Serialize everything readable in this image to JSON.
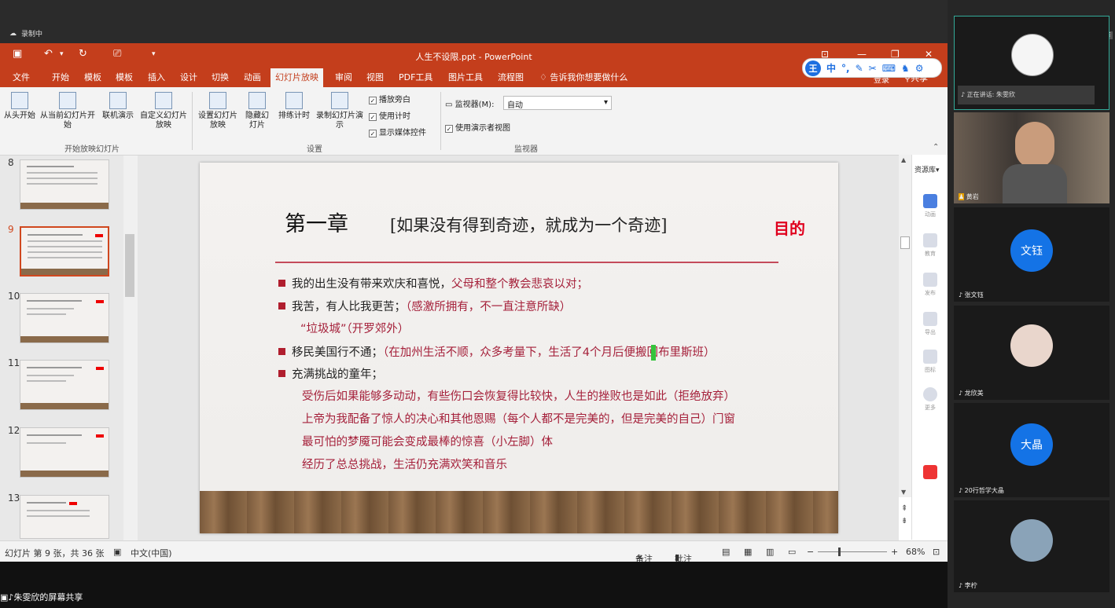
{
  "recording": {
    "label": "录制中"
  },
  "ppt": {
    "window_title": "人生不设限.ppt - PowerPoint",
    "tabs": [
      "文件",
      "开始",
      "模板",
      "模板",
      "插入",
      "设计",
      "切换",
      "动画",
      "幻灯片放映",
      "审阅",
      "视图",
      "PDF工具",
      "图片工具",
      "流程图"
    ],
    "active_tab": "幻灯片放映",
    "tell_me": "告诉我你想要做什么",
    "login": "登录",
    "share": "共享",
    "ime_logo": "王",
    "ime_mode": "中",
    "ribbon": {
      "from_start": "从头开始",
      "from_current": "从当前幻灯片开始",
      "online": "联机演示",
      "custom": "自定义幻灯片放映",
      "group1": "开始放映幻灯片",
      "setup": "设置幻灯片放映",
      "hide": "隐藏幻灯片",
      "rehearse": "排练计时",
      "record": "录制幻灯片演示",
      "play_narration": "播放旁白",
      "use_timings": "使用计时",
      "show_media": "显示媒体控件",
      "group2": "设置",
      "monitor_label": "监视器(M):",
      "monitor_value": "自动",
      "presenter_view": "使用演示者视图",
      "group3": "监视器"
    },
    "thumbnails": [
      "8",
      "9",
      "10",
      "11",
      "12",
      "13"
    ],
    "slide": {
      "title": "第一章",
      "subtitle": "[如果没有得到奇迹，就成为一个奇迹]",
      "mark": "目的",
      "lines": [
        {
          "black": "我的出生没有带来欢庆和喜悦，",
          "red": "父母和整个教会悲哀以对；"
        },
        {
          "black": "我苦，有人比我更苦；",
          "red": "（感激所拥有，不一直注意所缺）"
        },
        {
          "red": "“垃圾城”（开罗郊外）"
        },
        {
          "black": "移民美国行不通；",
          "red": "（在加州生活不顺，众多考量下，生活了4个月后便搬回布里斯班）"
        },
        {
          "black": "充满挑战的童年；"
        },
        {
          "red": "受伤后如果能够多动动，有些伤口会恢复得比较快，人生的挫败也是如此（拒绝放弃）"
        },
        {
          "red": "上帝为我配备了惊人的决心和其他恩赐（每个人都不是完美的，但是完美的自己）门窗"
        },
        {
          "red": "最可怕的梦魇可能会变成最棒的惊喜（小左脚）体"
        },
        {
          "red": "经历了总总挑战，生活仍充满欢笑和音乐"
        }
      ]
    },
    "resource_panel": {
      "title": "资源库",
      "items": [
        "动画",
        "教育",
        "发布",
        "导出",
        "图标",
        "更多"
      ]
    },
    "status": {
      "slide_info": "幻灯片 第 9 张，共 36 张",
      "language": "中文(中国)",
      "notes": "备注",
      "comments": "批注",
      "zoom": "68%"
    }
  },
  "meeting": {
    "speaking": "正在讲话: 朱雯欣",
    "share_label": "朱雯欣的屏幕共享",
    "participants": [
      {
        "name": "",
        "avatar_text": ""
      },
      {
        "name": "黄岩",
        "avatar_text": ""
      },
      {
        "name": "张文钰",
        "avatar_text": "文钰"
      },
      {
        "name": "龙欣美",
        "avatar_text": ""
      },
      {
        "name": "20行哲学大晶",
        "avatar_text": "大晶"
      },
      {
        "name": "李柠",
        "avatar_text": ""
      }
    ],
    "colors": {
      "accent": "#c43e1c",
      "avatar_blue": "#1473e6",
      "bullet_red": "#b01e2e"
    }
  }
}
